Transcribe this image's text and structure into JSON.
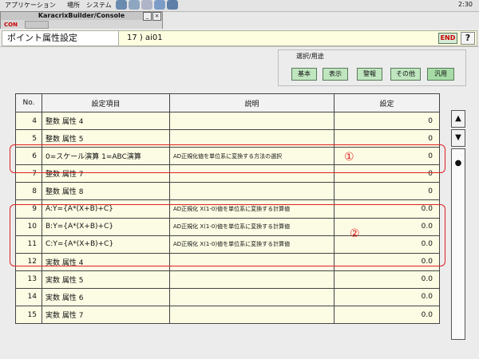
{
  "desktop": {
    "menu_apps": "アプリケーション",
    "menu_places": "場所",
    "menu_system": "システム",
    "clock": "2:30"
  },
  "window": {
    "title": "KaracrixBuilder/Console",
    "con_label": "CON"
  },
  "header": {
    "screen_title": "ポイント属性設定",
    "point_code": "17 ) ai01",
    "end_label": "END",
    "help_label": "?"
  },
  "selector": {
    "caption": "選択/用途",
    "buttons": [
      "基本",
      "表示",
      "警報",
      "その他",
      "汎用"
    ]
  },
  "table": {
    "headers": [
      "No.",
      "設定項目",
      "説明",
      "設定"
    ],
    "rows": [
      {
        "no": "4",
        "item": "整数 属性 4",
        "desc": "",
        "value": "0"
      },
      {
        "no": "5",
        "item": "整数 属性 5",
        "desc": "",
        "value": "0"
      },
      {
        "no": "6",
        "item": "0=スケール演算 1=ABC演算",
        "desc": "AD正規化値を単位系に変換する方法の選択",
        "value": "0"
      },
      {
        "no": "7",
        "item": "整数 属性 7",
        "desc": "",
        "value": "0"
      },
      {
        "no": "8",
        "item": "整数 属性 8",
        "desc": "",
        "value": "0"
      },
      {
        "no": "9",
        "item": "A:Y={A*(X+B)+C}",
        "desc": "AD正規化 X(1-0)値を単位系に変換する計算値",
        "value": "0.0"
      },
      {
        "no": "10",
        "item": "B:Y={A*(X+B)+C}",
        "desc": "AD正規化 X(1-0)値を単位系に変換する計算値",
        "value": "0.0"
      },
      {
        "no": "11",
        "item": "C:Y={A*(X+B)+C}",
        "desc": "AD正規化 X(1-0)値を単位系に変換する計算値",
        "value": "0.0"
      },
      {
        "no": "12",
        "item": "実数 属性 4",
        "desc": "",
        "value": "0.0"
      },
      {
        "no": "13",
        "item": "実数 属性 5",
        "desc": "",
        "value": "0.0"
      },
      {
        "no": "14",
        "item": "実数 属性 6",
        "desc": "",
        "value": "0.0"
      },
      {
        "no": "15",
        "item": "実数 属性 7",
        "desc": "",
        "value": "0.0"
      }
    ]
  },
  "scroll": {
    "up": "▲",
    "down": "▼",
    "dot": "●"
  },
  "annotations": {
    "mark1": "①",
    "mark2": "②"
  },
  "colors": {
    "row_bg": "#fcfce4",
    "button_green": "#bfe6bf",
    "annotation_red": "#e02020"
  }
}
